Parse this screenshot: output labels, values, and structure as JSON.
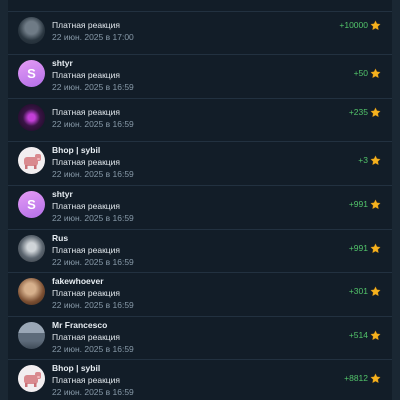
{
  "transactions": [
    {
      "name": "",
      "reaction": "",
      "date": "22 июн. 2025 в 17:00",
      "amount": "",
      "avatar": "dark-photo",
      "avatar_letter": ""
    },
    {
      "name": "",
      "reaction": "Платная реакция",
      "date": "22 июн. 2025 в 17:00",
      "amount": "+10000",
      "avatar": "dark-photo",
      "avatar_letter": ""
    },
    {
      "name": "shtyr",
      "reaction": "Платная реакция",
      "date": "22 июн. 2025 в 16:59",
      "amount": "+50",
      "avatar": "letter-purple",
      "avatar_letter": "S"
    },
    {
      "name": "",
      "reaction": "Платная реакция",
      "date": "22 июн. 2025 в 16:59",
      "amount": "+235",
      "avatar": "neon-photo",
      "avatar_letter": ""
    },
    {
      "name": "Bhop | sybil",
      "reaction": "Платная реакция",
      "date": "22 июн. 2025 в 16:59",
      "amount": "+3",
      "avatar": "pink-cow",
      "avatar_letter": ""
    },
    {
      "name": "shtyr",
      "reaction": "Платная реакция",
      "date": "22 июн. 2025 в 16:59",
      "amount": "+991",
      "avatar": "letter-purple",
      "avatar_letter": "S"
    },
    {
      "name": "Rus",
      "reaction": "Платная реакция",
      "date": "22 июн. 2025 в 16:59",
      "amount": "+991",
      "avatar": "photo-man",
      "avatar_letter": ""
    },
    {
      "name": "fakewhoever",
      "reaction": "Платная реакция",
      "date": "22 июн. 2025 в 16:59",
      "amount": "+301",
      "avatar": "photo-brown",
      "avatar_letter": ""
    },
    {
      "name": "Mr Francesco",
      "reaction": "Платная реакция",
      "date": "22 июн. 2025 в 16:59",
      "amount": "+514",
      "avatar": "photo-city",
      "avatar_letter": ""
    },
    {
      "name": "Bhop | sybil",
      "reaction": "Платная реакция",
      "date": "22 июн. 2025 в 16:59",
      "amount": "+8812",
      "avatar": "pink-cow",
      "avatar_letter": ""
    }
  ],
  "colors": {
    "background": "#121d28",
    "positive_amount": "#52c46a",
    "star": "#f5b21f",
    "divider": "#223140"
  },
  "icons": {
    "amount_icon": "star-icon"
  }
}
